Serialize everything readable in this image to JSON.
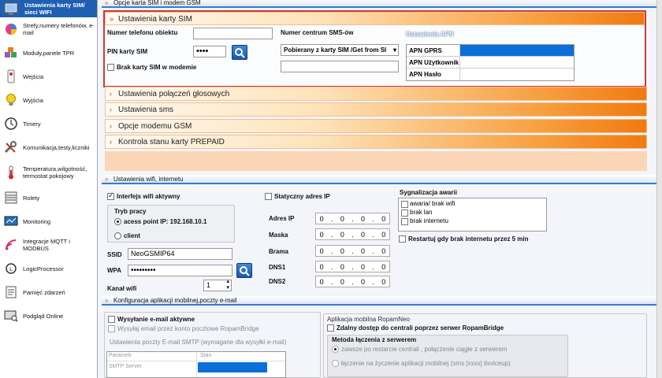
{
  "sidebar": {
    "items": [
      {
        "label": "Ustawienia karty SIM/ sieci WIFI",
        "icon": "sim-wifi-icon"
      },
      {
        "label": "Strefy,numery telefonów, e-mail",
        "icon": "zones-pie-icon"
      },
      {
        "label": "Moduły,panele TPR",
        "icon": "modules-cubes-icon"
      },
      {
        "label": "Wejścia",
        "icon": "inputs-sensor-icon"
      },
      {
        "label": "Wyjścia",
        "icon": "outputs-bulb-icon"
      },
      {
        "label": "Timery",
        "icon": "timer-clock-icon"
      },
      {
        "label": "Komunikacja,testy,liczniki",
        "icon": "tools-wrench-icon"
      },
      {
        "label": "Temperatura,wilgotność, termostat pokojowy",
        "icon": "thermometer-icon"
      },
      {
        "label": "Rolety",
        "icon": "blinds-icon"
      },
      {
        "label": "Monitoring",
        "icon": "monitoring-icon"
      },
      {
        "label": "Integracje MQTT i MODBUS",
        "icon": "mqtt-icon"
      },
      {
        "label": "LogicProcessor",
        "icon": "logic-processor-icon"
      },
      {
        "label": "Pamięć zdarzeń",
        "icon": "event-memory-icon"
      },
      {
        "label": "Podgląd Online",
        "icon": "online-preview-icon"
      }
    ]
  },
  "sections": {
    "gsm_title": "Opcje karta SIM i modem GSM",
    "wifi_title": "Ustawienia wifi, internetu",
    "app_title": "Konfiguracja aplikacji mobilnej,poczty e-mail"
  },
  "sim": {
    "header": "Ustawienia karty SIM",
    "phone_label": "Numer telefonu obiektu",
    "phone_value": "",
    "pin_label": "PIN karty SIM",
    "pin_value": "••••",
    "no_sim_label": "Brak karty SIM w modemie",
    "sms_center_label": "Numer centrum SMS-ów",
    "sms_center_select": "Pobierany z karty SIM /Get from SI",
    "sms_center_value": "",
    "apn_title": "Ustawienia APN",
    "apn_rows": [
      {
        "key": "APN GPRS",
        "value": ""
      },
      {
        "key": "APN Użytkownik",
        "value": ""
      },
      {
        "key": "APN Hasło",
        "value": ""
      }
    ]
  },
  "collapsed": [
    "Ustawienia połączeń głosowych",
    "Ustawienia sms",
    "Opcje modemu GSM",
    "Kontrola stanu karty PREPAID"
  ],
  "wifi": {
    "enabled_label": "Interfejs wifi aktywny",
    "mode_label": "Tryb pracy",
    "ap_label": "acess point IP: 192.168.10.1",
    "client_label": "client",
    "ssid_label": "SSID",
    "ssid_value": "NeoGSMIP64",
    "wpa_label": "WPA",
    "wpa_value": "•••••••••",
    "channel_label": "Kanał wifi",
    "channel_value": "1",
    "static_label": "Statyczny adres IP",
    "ip_fields": [
      {
        "label": "Adres IP",
        "value": [
          "0",
          "0",
          "0",
          "0"
        ]
      },
      {
        "label": "Maska",
        "value": [
          "0",
          "0",
          "0",
          "0"
        ]
      },
      {
        "label": "Brama",
        "value": [
          "0",
          "0",
          "0",
          "0"
        ]
      },
      {
        "label": "DNS1",
        "value": [
          "0",
          "0",
          "0",
          "0"
        ]
      },
      {
        "label": "DNS2",
        "value": [
          "0",
          "0",
          "0",
          "0"
        ]
      }
    ],
    "alarm_title": "Sygnalizacja awarii",
    "alarm_items": [
      "awaria/ brak wifi",
      "brak lan",
      "brak internetu"
    ],
    "restart_label": "Restartuj gdy brak internetu przez 5 min"
  },
  "app": {
    "email_enabled": "Wysyłanie e-mail aktywne",
    "send_via_bridge": "Wysyłaj email przez konto pocztowe RopamBridge",
    "smtp_title": "Ustawienia poczty E-mail SMTP (wymagane dla wysyłki e-mail)",
    "smtp_col1": "Parametr",
    "smtp_col2": "Stan",
    "smtp_row1": "SMTP Server",
    "mobile_group_title": "Aplikacja mobilna RopamNeo",
    "remote_access": "Zdalny dostęp do centrali poprzez serwer RopamBridge",
    "method_title": "Metoda łączenia z serwerem",
    "method_opt1": "zawsze po restarcie centrali , połączenie ciągłe z serwerem",
    "method_opt2": "łączenie na życzenie aplikacji mobilnej  (sms [xxxx] tlsviceup)"
  }
}
